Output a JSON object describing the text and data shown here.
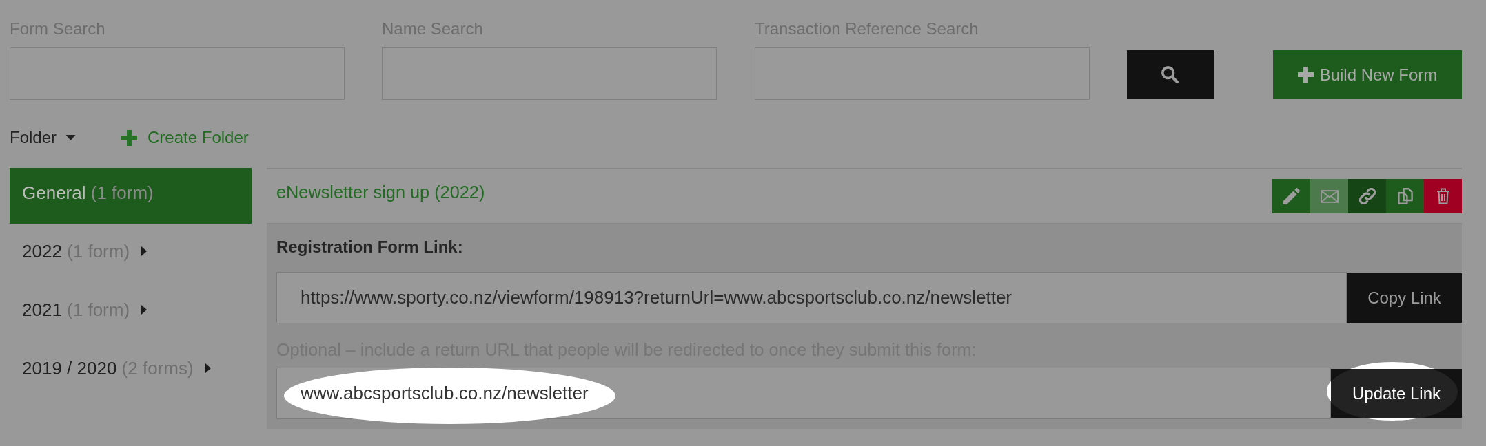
{
  "search": {
    "fields": [
      {
        "label": "Form Search"
      },
      {
        "label": "Name Search"
      },
      {
        "label": "Transaction Reference Search"
      }
    ],
    "build_button": {
      "label": "Build New Form"
    }
  },
  "folders": {
    "dropdown": {
      "label": "Folder"
    },
    "create_button": {
      "label": "Create Folder"
    },
    "items": [
      {
        "name": "General",
        "count": "(1 form)",
        "selected": true,
        "has_subfolders": false
      },
      {
        "name": "2022",
        "count": "(1 form)",
        "selected": false,
        "has_subfolders": true
      },
      {
        "name": "2021",
        "count": "(1 form)",
        "selected": false,
        "has_subfolders": true
      },
      {
        "name": "2019 / 2020",
        "count": "(2 forms)",
        "selected": false,
        "has_subfolders": true
      }
    ]
  },
  "forms": [
    {
      "title": "eNewsletter sign up (2022)",
      "actions": [
        {
          "kind": "edit",
          "color": "#1e5c1e"
        },
        {
          "kind": "email",
          "color": "#4d7a4d"
        },
        {
          "kind": "link",
          "color": "#154515"
        },
        {
          "kind": "copy",
          "color": "#1e5c1e"
        },
        {
          "kind": "delete",
          "color": "#a00022"
        }
      ],
      "expanded": true,
      "link_panel": {
        "heading": "Registration Form Link:",
        "link": "https://www.sporty.co.nz/viewform/198913?returnUrl=www.abcsportsclub.co.nz/newsletter",
        "copy_button": {
          "label": "Copy Link"
        },
        "hint": "Optional – include a return URL that people will be redirected to once they submit this form:",
        "return_url": {
          "value": "www.abcsportsclub.co.nz/newsletter",
          "highlighted": true
        },
        "update_button": {
          "label": "Update Link",
          "highlighted": true
        }
      }
    }
  ]
}
